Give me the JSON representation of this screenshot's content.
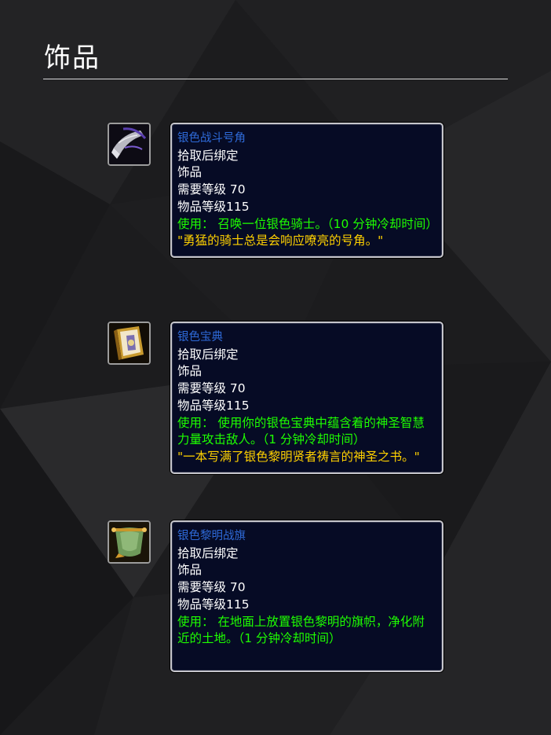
{
  "page": {
    "title": "饰品"
  },
  "items": [
    {
      "icon": "silver-war-horn-icon",
      "name": "银色战斗号角",
      "binding": "拾取后绑定",
      "slot": "饰品",
      "required_level": "需要等级 70",
      "item_level": "物品等级115",
      "use_text": "使用： 召唤一位银色骑士。（10 分钟冷却时间）",
      "flavor": "\"勇猛的骑士总是会响应嘹亮的号角。\""
    },
    {
      "icon": "silver-tome-icon",
      "name": "银色宝典",
      "binding": "拾取后绑定",
      "slot": "饰品",
      "required_level": "需要等级 70",
      "item_level": "物品等级115",
      "use_text": "使用： 使用你的银色宝典中蕴含着的神圣智慧力量攻击敌人。（1 分钟冷却时间）",
      "flavor": "\"一本写满了银色黎明贤者祷言的神圣之书。\""
    },
    {
      "icon": "argent-dawn-banner-icon",
      "name": "银色黎明战旗",
      "binding": "拾取后绑定",
      "slot": "饰品",
      "required_level": "需要等级 70",
      "item_level": "物品等级115",
      "use_text": "使用： 在地面上放置银色黎明的旗帜，净化附近的土地。（1 分钟冷却时间）"
    }
  ],
  "colors": {
    "background": "#1b1b1d",
    "tooltip_bg": "#060b25",
    "tooltip_border": "#c6c6cc",
    "item_name": "#2e6ad8",
    "use_effect": "#1eff00",
    "flavor_text": "#ffd100",
    "normal_text": "#ffffff"
  }
}
